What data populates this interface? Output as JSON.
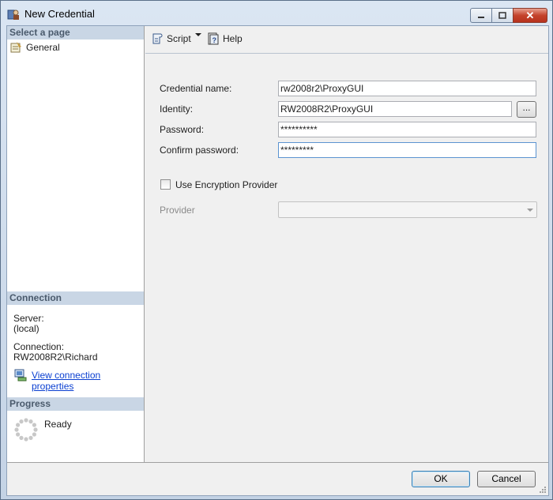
{
  "window": {
    "title": "New Credential",
    "close_glyph": "✕"
  },
  "sidebar": {
    "select_page_header": "Select a page",
    "pages": [
      {
        "label": "General",
        "icon": "general-page-icon"
      }
    ],
    "connection_header": "Connection",
    "server_label": "Server:",
    "server_value": "(local)",
    "connection_label": "Connection:",
    "connection_value": "RW2008R2\\Richard",
    "view_properties_link": "View connection properties",
    "progress_header": "Progress",
    "progress_status": "Ready"
  },
  "toolbar": {
    "script_label": "Script",
    "help_label": "Help"
  },
  "form": {
    "credential_name_label": "Credential name:",
    "credential_name_value": "rw2008r2\\ProxyGUI",
    "identity_label": "Identity:",
    "identity_value": "RW2008R2\\ProxyGUI",
    "browse_label": "...",
    "password_label": "Password:",
    "password_value": "**********",
    "confirm_password_label": "Confirm password:",
    "confirm_password_value": "*********",
    "use_encryption_label": "Use Encryption Provider",
    "use_encryption_checked": false,
    "provider_label": "Provider",
    "provider_value": ""
  },
  "buttons": {
    "ok_label": "OK",
    "cancel_label": "Cancel"
  },
  "colors": {
    "link": "#0a3fd1",
    "section_header_bg": "#c9d6e5",
    "focus_border": "#5b93d1"
  }
}
